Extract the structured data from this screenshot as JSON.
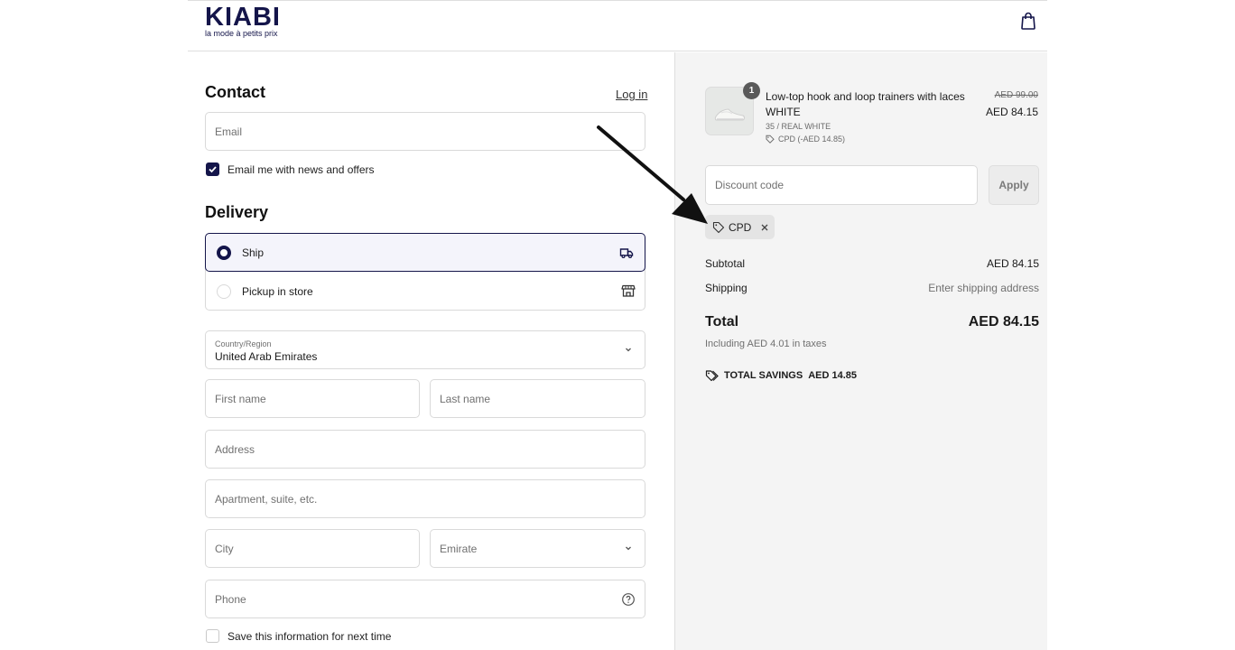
{
  "header": {
    "logo_word": "KIABI",
    "logo_tagline": "la mode à petits prix",
    "bag_icon": "shopping-bag-icon"
  },
  "contact": {
    "title": "Contact",
    "login_label": "Log in",
    "email_placeholder": "Email",
    "newsletter_label": "Email me with news and offers",
    "newsletter_checked": true
  },
  "delivery": {
    "title": "Delivery",
    "options": [
      {
        "label": "Ship",
        "selected": true,
        "icon": "truck-icon"
      },
      {
        "label": "Pickup in store",
        "selected": false,
        "icon": "store-icon"
      }
    ],
    "country_label": "Country/Region",
    "country_value": "United Arab Emirates",
    "first_name_placeholder": "First name",
    "last_name_placeholder": "Last name",
    "address_placeholder": "Address",
    "apartment_placeholder": "Apartment, suite, etc.",
    "city_placeholder": "City",
    "emirate_placeholder": "Emirate",
    "phone_placeholder": "Phone",
    "save_info_label": "Save this information for next time",
    "save_info_checked": false
  },
  "summary": {
    "item": {
      "quantity": "1",
      "name_line1": "Low-top hook and loop trainers with laces",
      "name_line2": "WHITE",
      "variant": "35 / REAL WHITE",
      "discount": "CPD (-AED 14.85)",
      "old_price": "AED 99.00",
      "new_price": "AED 84.15"
    },
    "discount_placeholder": "Discount code",
    "apply_label": "Apply",
    "applied_code": "CPD",
    "subtotal_label": "Subtotal",
    "subtotal_value": "AED 84.15",
    "shipping_label": "Shipping",
    "shipping_value": "Enter shipping address",
    "total_label": "Total",
    "total_value": "AED 84.15",
    "tax_note": "Including AED 4.01 in taxes",
    "savings_label": "TOTAL SAVINGS",
    "savings_value": "AED 14.85"
  },
  "colors": {
    "brand": "#14154a",
    "summary_bg": "#f4f4f4",
    "border": "#d9d9d9"
  }
}
